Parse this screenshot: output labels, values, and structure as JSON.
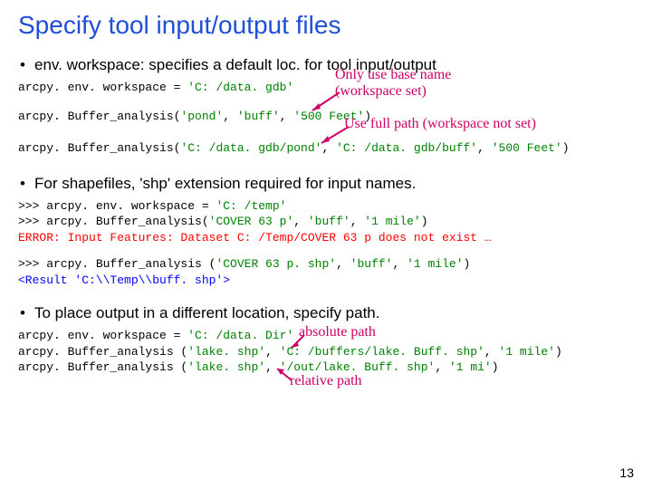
{
  "title": "Specify tool input/output files",
  "bullet1": "env. workspace: specifies a default loc. for tool input/output",
  "code1_line1_a": "arcpy. env. workspace = ",
  "code1_line1_b": "'C: /data. gdb'",
  "annot1_line1": "Only use base name",
  "annot1_line2": "(workspace set)",
  "code1_line2_a": "arcpy. Buffer_analysis(",
  "code1_line2_b": "'pond'",
  "code1_line2_c": ", ",
  "code1_line2_d": "'buff'",
  "code1_line2_e": ", ",
  "code1_line2_f": "'500 Feet'",
  "code1_line2_g": ")",
  "annot2": "Use full path (workspace not set)",
  "code1_line3_a": "arcpy. Buffer_analysis(",
  "code1_line3_b": "'C: /data. gdb/pond'",
  "code1_line3_c": ", ",
  "code1_line3_d": "'C: /data. gdb/buff'",
  "code1_line3_e": ", ",
  "code1_line3_f": "'500 Feet'",
  "code1_line3_g": ")",
  "bullet2": "For shapefiles, 'shp' extension required for input names.",
  "code2_line1_a": ">>> arcpy. env. workspace = ",
  "code2_line1_b": "'C: /temp'",
  "code2_line2_a": ">>> arcpy. Buffer_analysis(",
  "code2_line2_b": "'COVER 63 p'",
  "code2_line2_c": ", ",
  "code2_line2_d": "'buff'",
  "code2_line2_e": ", ",
  "code2_line2_f": "'1 mile'",
  "code2_line2_g": ")",
  "code2_err": "ERROR: Input Features: Dataset C: /Temp/COVER 63 p does not exist …",
  "code3_line1_a": ">>> arcpy. Buffer_analysis (",
  "code3_line1_b": "'COVER 63 p. shp'",
  "code3_line1_c": ", ",
  "code3_line1_d": "'buff'",
  "code3_line1_e": ", ",
  "code3_line1_f": "'1 mile'",
  "code3_line1_g": ")",
  "code3_res": "<Result 'C:\\\\Temp\\\\buff. shp'>",
  "bullet3": "To place output in a different location, specify path.",
  "code4_line1_a": "arcpy. env. workspace = ",
  "code4_line1_b": "'C: /data. Dir'",
  "annot3": "absolute path",
  "code4_line2_a": "arcpy. Buffer_analysis (",
  "code4_line2_b": "'lake. shp'",
  "code4_line2_c": ", ",
  "code4_line2_d": "'C: /buffers/lake. Buff. shp'",
  "code4_line2_e": ", ",
  "code4_line2_f": "'1 mile'",
  "code4_line2_g": ")",
  "code4_line3_a": "arcpy. Buffer_analysis (",
  "code4_line3_b": "'lake. shp'",
  "code4_line3_c": ", ",
  "code4_line3_d": "'/out/lake. Buff. shp'",
  "code4_line3_e": ", ",
  "code4_line3_f": "'1 mi'",
  "code4_line3_g": ")",
  "annot4": "relative path",
  "pagenum": "13"
}
